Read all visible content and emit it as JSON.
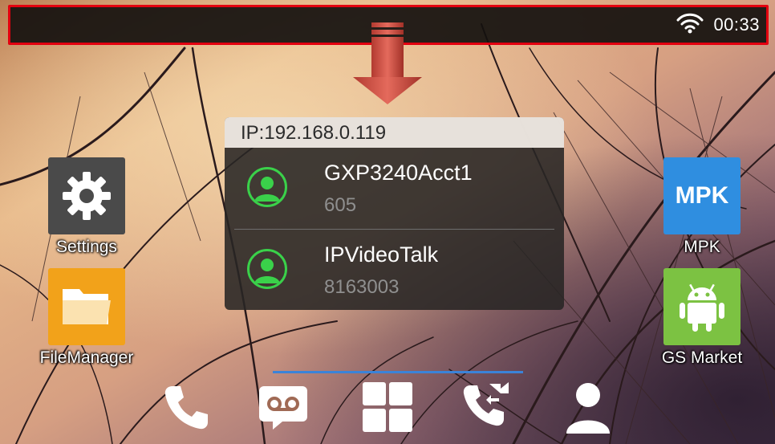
{
  "status_bar": {
    "time": "00:33",
    "wifi_icon": "wifi-icon",
    "highlight_color": "#e3000f"
  },
  "drag_hint": {
    "icon": "arrow-down-icon",
    "color": "#c84a3e"
  },
  "apps": {
    "settings": {
      "label": "Settings",
      "icon": "gear-icon",
      "color": "#4a4a4a"
    },
    "file_manager": {
      "label": "FileManager",
      "icon": "folder-icon",
      "color": "#f2a21a"
    },
    "mpk": {
      "label": "MPK",
      "tile_text": "MPK",
      "color": "#2f8ee0"
    },
    "gs_market": {
      "label": "GS Market",
      "icon": "android-icon",
      "color": "#7cc242"
    }
  },
  "account_widget": {
    "ip": "IP:192.168.0.119",
    "accounts": [
      {
        "name": "GXP3240Acct1",
        "number": "605",
        "status_color": "#3ad14a"
      },
      {
        "name": "IPVideoTalk",
        "number": "8163003",
        "status_color": "#3ad14a"
      }
    ]
  },
  "dock": {
    "items": [
      "phone-icon",
      "voicemail-icon",
      "apps-grid-icon",
      "call-transfer-icon",
      "contacts-icon"
    ],
    "indicator_color": "#3b83d8"
  }
}
